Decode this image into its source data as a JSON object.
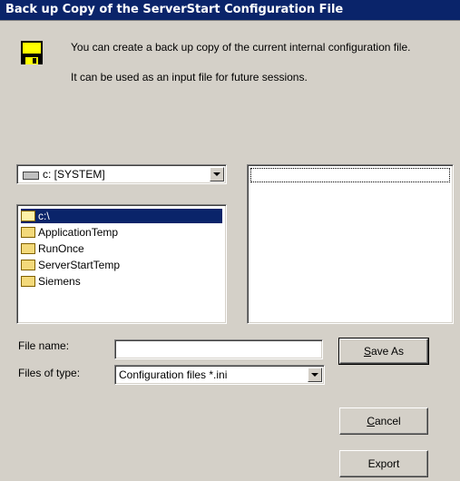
{
  "dialog": {
    "title": "Back up Copy of the ServerStart Configuration File",
    "message_line1": "You can create a back up copy of the current internal configuration file.",
    "message_line2": "It can be used as an input file for future sessions."
  },
  "drive": {
    "selected": "c: [SYSTEM]"
  },
  "directories": [
    {
      "label": "c:\\",
      "selected": true,
      "open": true
    },
    {
      "label": "ApplicationTemp",
      "selected": false,
      "open": false
    },
    {
      "label": "RunOnce",
      "selected": false,
      "open": false
    },
    {
      "label": "ServerStartTemp",
      "selected": false,
      "open": false
    },
    {
      "label": "Siemens",
      "selected": false,
      "open": false
    }
  ],
  "form": {
    "file_name_label": "File name:",
    "file_name_value": "",
    "files_of_type_label": "Files of type:",
    "files_of_type_value": "Configuration files *.ini"
  },
  "buttons": {
    "save_as_mnemonic": "S",
    "save_as_rest": "ave As",
    "cancel_mnemonic": "C",
    "cancel_rest": "ancel",
    "export": "Export"
  },
  "icons": {
    "dialog_icon": "floppy-disk-icon",
    "drive_icon": "hard-drive-icon",
    "folder_icon": "folder-icon"
  }
}
